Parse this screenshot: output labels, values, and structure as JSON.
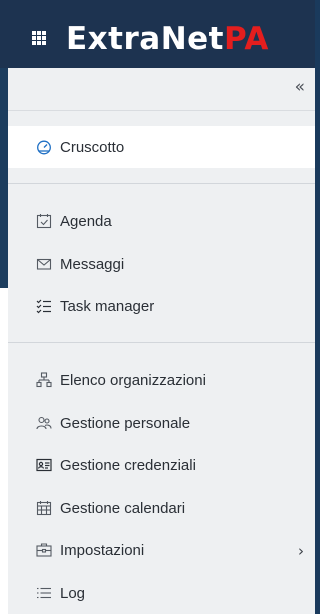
{
  "header": {
    "logo_main": "ExtraNet",
    "logo_accent": "PA"
  },
  "panel": {
    "collapse_glyph": "«"
  },
  "nav": {
    "cruscotto": "Cruscotto",
    "agenda": "Agenda",
    "messaggi": "Messaggi",
    "task_manager": "Task manager",
    "elenco_organizzazioni": "Elenco organizzazioni",
    "gestione_personale": "Gestione personale",
    "gestione_credenziali": "Gestione credenziali",
    "gestione_calendari": "Gestione calendari",
    "impostazioni": "Impostazioni",
    "log": "Log"
  },
  "colors": {
    "header_bg": "#1d3350",
    "accent": "#e41e1e",
    "active_icon": "#1e6fc4"
  },
  "icons": {
    "cruscotto": "dashboard-gauge-icon",
    "agenda": "calendar-check-icon",
    "messaggi": "envelope-icon",
    "task_manager": "checklist-icon",
    "elenco_organizzazioni": "org-chart-icon",
    "gestione_personale": "people-icon",
    "gestione_credenziali": "id-card-icon",
    "gestione_calendari": "calendar-grid-icon",
    "impostazioni": "toolbox-icon",
    "log": "list-icon"
  }
}
